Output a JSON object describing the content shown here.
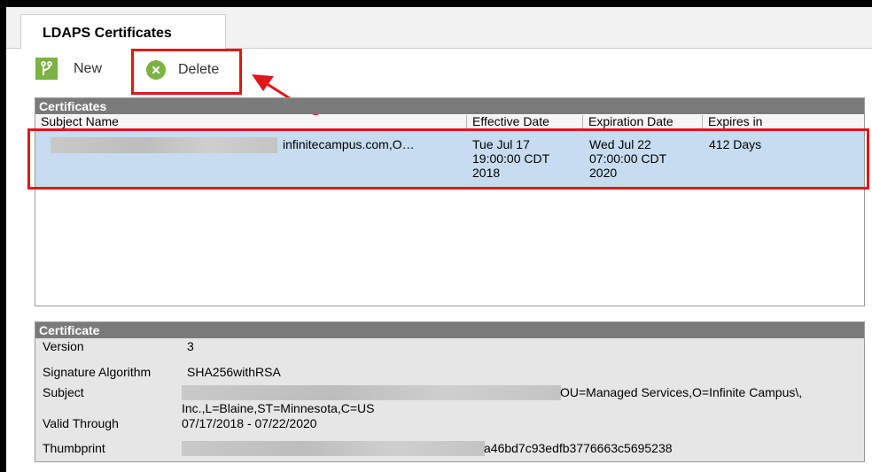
{
  "tab": {
    "title": "LDAPS Certificates"
  },
  "toolbar": {
    "new_label": "New",
    "delete_label": "Delete"
  },
  "certificates": {
    "header": "Certificates",
    "columns": [
      "Subject Name",
      "Effective Date",
      "Expiration Date",
      "Expires in"
    ],
    "rows": [
      {
        "subject": "infinitecampus.com,O…",
        "effective": [
          "Tue Jul 17",
          "19:00:00 CDT",
          "2018"
        ],
        "expiration": [
          "Wed Jul 22",
          "07:00:00 CDT",
          "2020"
        ],
        "expires_in": "412 Days"
      }
    ]
  },
  "certificate": {
    "header": "Certificate",
    "fields": [
      {
        "label": "Version",
        "value": "3"
      },
      {
        "label": "Signature Algorithm",
        "value": "SHA256withRSA"
      },
      {
        "label": "Subject",
        "value": "OU=Managed Services,O=Infinite Campus\\,",
        "value2": "Inc.,L=Blaine,ST=Minnesota,C=US"
      },
      {
        "label": "Valid Through",
        "value": "07/17/2018 - 07/22/2020"
      },
      {
        "label": "Thumbprint",
        "value": "a46bd7c93edfb3776663c5695238"
      }
    ]
  },
  "colors": {
    "highlight": "#e0161b",
    "accent": "#7cb342",
    "selected_row": "#c7dcf0",
    "panel_header": "#7a7a7a"
  },
  "icons": {
    "new": "branch-icon",
    "delete": "x-circle-icon"
  }
}
